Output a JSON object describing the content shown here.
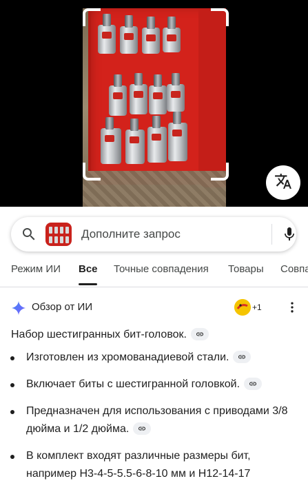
{
  "search": {
    "placeholder": "Дополните запрос"
  },
  "tabs": [
    {
      "label": "Режим ИИ"
    },
    {
      "label": "Все"
    },
    {
      "label": "Точные совпадения"
    },
    {
      "label": "Товары"
    },
    {
      "label": "Совпа"
    }
  ],
  "ai_overview": {
    "title": "Обзор от ИИ",
    "contributors": "+1",
    "summary": "Набор шестигранных бит-головок.",
    "bullets": [
      "Изготовлен из хромованадиевой стали.",
      "Включает биты с шестигранной головкой.",
      "Предназначен для использования с приводами 3/8 дюйма и 1/2 дюйма.",
      "В комплект входят различные размеры бит, например H3-4-5-5.5-6-8-10 мм и H12-14-17"
    ]
  },
  "icons": {
    "search": "search-icon",
    "mic": "mic-icon",
    "translate": "translate-icon",
    "sparkle": "gemini-sparkle-icon",
    "more": "more-vert-icon",
    "link": "link-icon"
  },
  "colors": {
    "accent_blue": "#4285f4",
    "case_red": "#d3221b",
    "text": "#1f1f1f"
  }
}
